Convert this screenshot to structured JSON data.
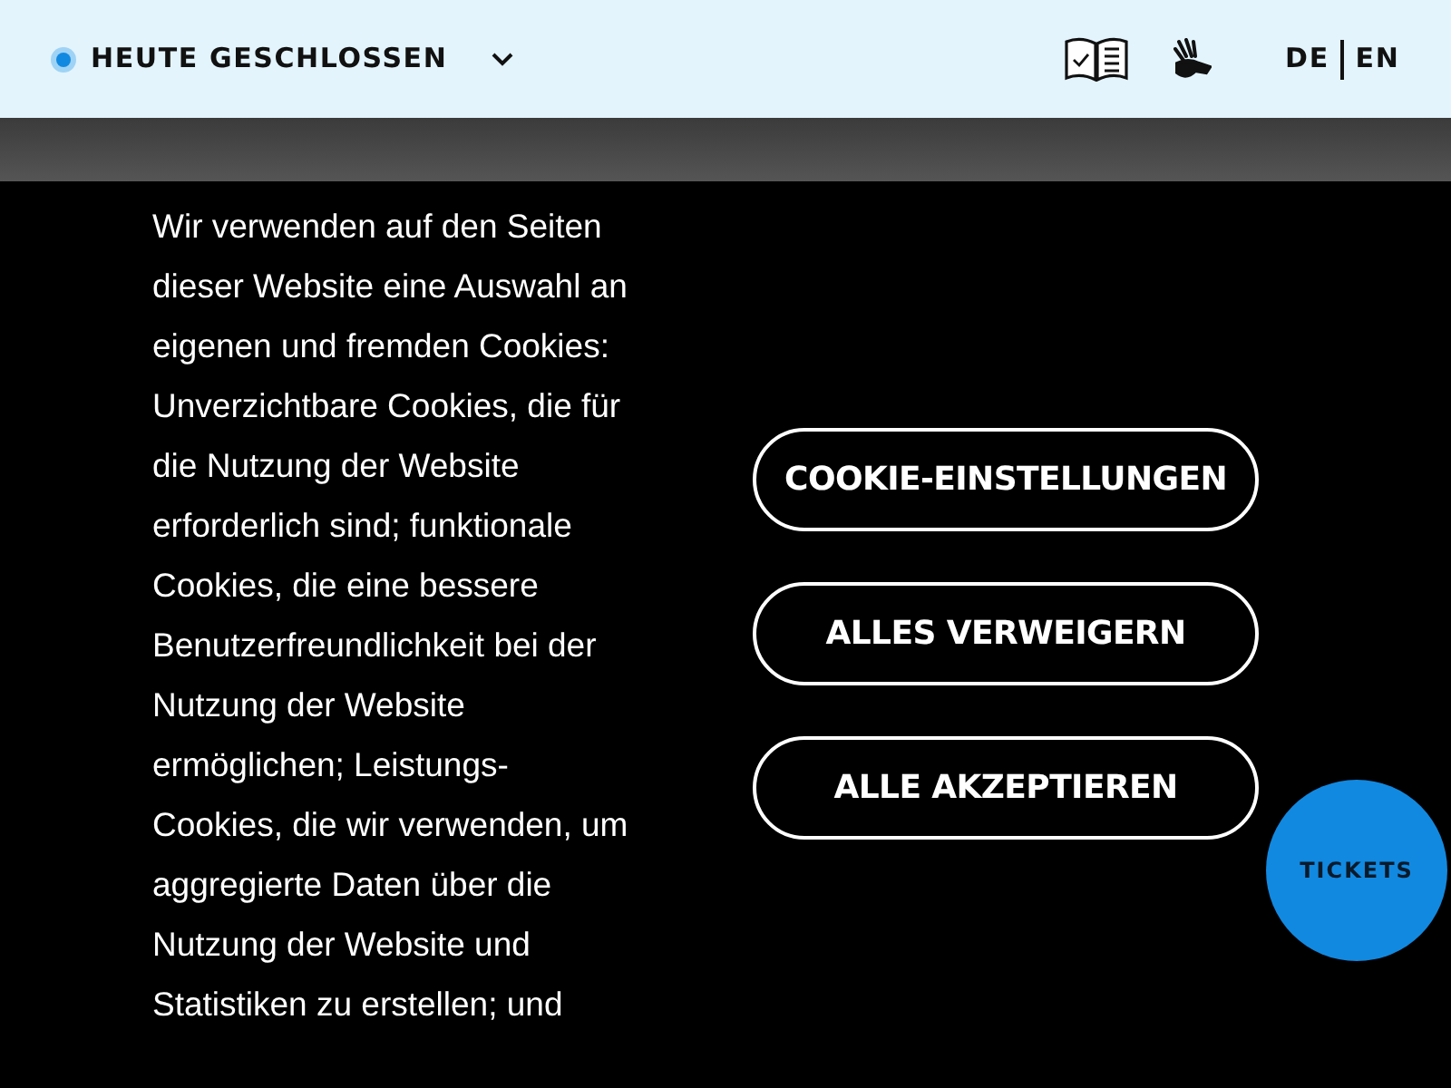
{
  "header": {
    "status": "HEUTE GESCHLOSSEN",
    "languages": [
      "DE",
      "EN"
    ]
  },
  "cookie_banner": {
    "text": "Wir verwenden auf den Seiten\ndieser Website eine Auswahl an\neigenen und fremden Cookies:\nUnverzichtbare Cookies, die für\ndie Nutzung der Website\nerforderlich sind; funktionale\nCookies, die eine bessere\nBenutzerfreundlichkeit bei der\nNutzung der Website\nermöglichen; Leistungs-\nCookies, die wir verwenden, um\naggregierte Daten über die\nNutzung der Website und\nStatistiken zu erstellen; und",
    "buttons": [
      "COOKIE-EINSTELLUNGEN",
      "ALLES VERWEIGERN",
      "ALLE AKZEPTIEREN"
    ]
  },
  "tickets_button": "TICKETS"
}
